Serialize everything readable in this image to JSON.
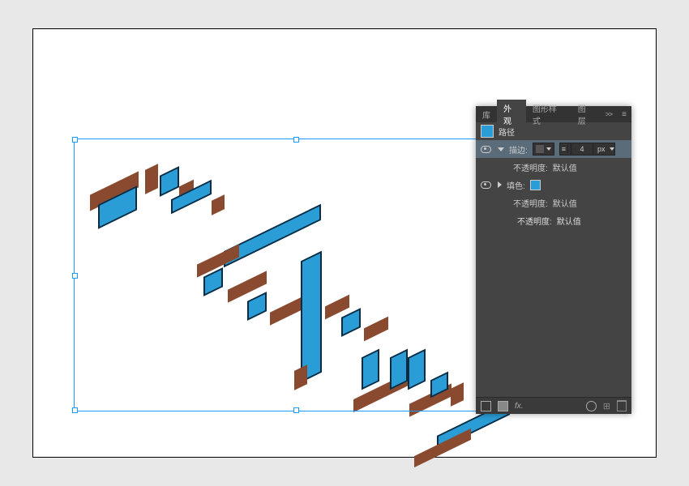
{
  "panel": {
    "tabs": [
      "库",
      "外观",
      "图形样式",
      "图层"
    ],
    "active_tab": "外观",
    "object_label": "路径",
    "stroke": {
      "label": "描边:",
      "weight_value": "4",
      "weight_unit": "px",
      "opacity_label": "不透明度:",
      "opacity_value": "默认值"
    },
    "fill": {
      "label": "填色:",
      "opacity_label": "不透明度:",
      "opacity_value": "默认值"
    },
    "object_opacity": {
      "label": "不透明度:",
      "value": "默认值"
    },
    "footer_fx": "fx."
  },
  "colors": {
    "fill_hex": "#2a9dd6",
    "stroke_hex": "#0a2b42",
    "side_hex": "#8a4a2f"
  },
  "stroke_weight_px": 4
}
